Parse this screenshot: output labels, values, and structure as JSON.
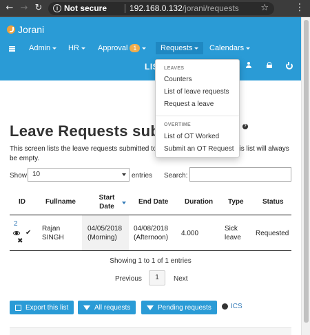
{
  "browser": {
    "security_label": "Not secure",
    "url_host": "192.168.0.132",
    "url_path": "/jorani/requests"
  },
  "app": {
    "brand": "Jorani",
    "nav": [
      {
        "label": "Admin",
        "has_caret": true
      },
      {
        "label": "HR",
        "has_caret": true
      },
      {
        "label": "Approval",
        "badge": "1",
        "has_caret": true
      },
      {
        "label": "Requests",
        "has_caret": true
      },
      {
        "label": "Calendars",
        "has_caret": true
      }
    ],
    "subnav_text": "LIS"
  },
  "dropdown": {
    "leaves_header": "LEAVES",
    "leaves_items": [
      "Counters",
      "List of leave requests",
      "Request a leave"
    ],
    "overtime_header": "OVERTIME",
    "overtime_items": [
      "List of OT Worked",
      "Submit an OT Request"
    ]
  },
  "page": {
    "title": "Leave Requests subm",
    "description_1a": "This screen lists the leave requests submitted to yo",
    "description_1b": "his list will always",
    "description_2": "be empty."
  },
  "table_controls": {
    "show_label": "Show",
    "page_length": "10",
    "entries_label": "entries",
    "search_label": "Search:",
    "search_value": ""
  },
  "table": {
    "headers": [
      "ID",
      "Fullname",
      "Start Date",
      "End Date",
      "Duration",
      "Type",
      "Status"
    ],
    "rows": [
      {
        "id": "2",
        "fullname_1": "Rajan",
        "fullname_2": "SINGH",
        "start_1": "04/05/2018",
        "start_2": "(Morning)",
        "end_1": "04/08/2018",
        "end_2": "(Afternoon)",
        "duration": "4.000",
        "type_1": "Sick",
        "type_2": "leave",
        "status": "Requested"
      }
    ],
    "info": "Showing 1 to 1 of 1 entries",
    "pagination": {
      "previous": "Previous",
      "current": "1",
      "next": "Next"
    }
  },
  "actions": {
    "export": "Export this list",
    "all": "All requests",
    "pending": "Pending requests",
    "ics": "ICS"
  },
  "colors": {
    "brand_blue": "#2a9bd6",
    "badge_orange": "#f0ad4e",
    "link": "#337ab7"
  }
}
